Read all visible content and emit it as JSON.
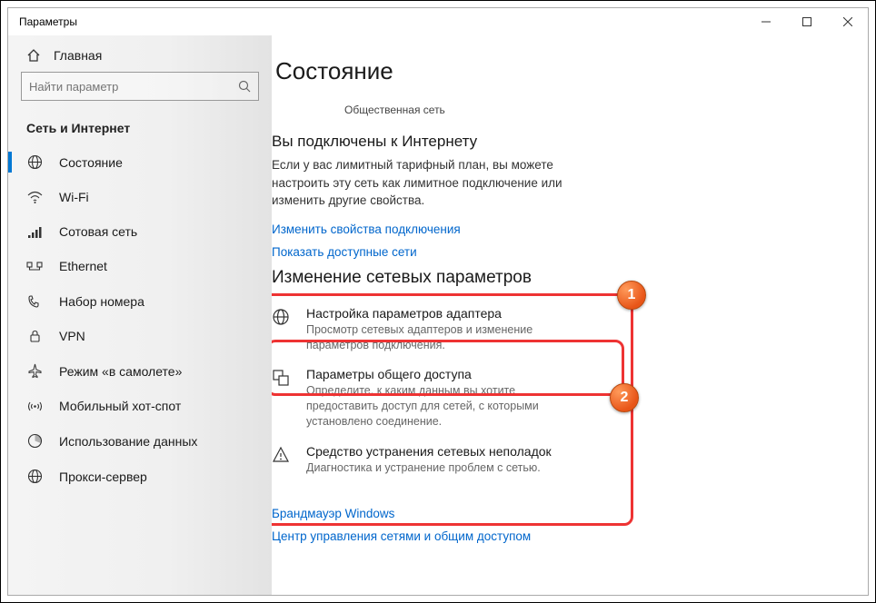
{
  "window": {
    "title": "Параметры"
  },
  "sidebar": {
    "home": "Главная",
    "search_placeholder": "Найти параметр",
    "section": "Сеть и Интернет",
    "items": [
      {
        "label": "Состояние"
      },
      {
        "label": "Wi-Fi"
      },
      {
        "label": "Сотовая сеть"
      },
      {
        "label": "Ethernet"
      },
      {
        "label": "Набор номера"
      },
      {
        "label": "VPN"
      },
      {
        "label": "Режим «в самолете»"
      },
      {
        "label": "Мобильный хот-спот"
      },
      {
        "label": "Использование данных"
      },
      {
        "label": "Прокси-сервер"
      }
    ]
  },
  "main": {
    "title": "Состояние",
    "network_type": "Общественная сеть",
    "connected_title": "Вы подключены к Интернету",
    "connected_text": "Если у вас лимитный тарифный план, вы можете настроить эту сеть как лимитное подключение или изменить другие свойства.",
    "link_change_props": "Изменить свойства подключения",
    "link_show_networks": "Показать доступные сети",
    "section2_title": "Изменение сетевых параметров",
    "opt_adapter": {
      "title": "Настройка параметров адаптера",
      "desc": "Просмотр сетевых адаптеров и изменение параметров подключения."
    },
    "opt_sharing": {
      "title": "Параметры общего доступа",
      "desc": "Определите, к каким данным вы хотите предоставить доступ для сетей, с которыми установлено соединение."
    },
    "opt_trouble": {
      "title": "Средство устранения сетевых неполадок",
      "desc": "Диагностика и устранение проблем с сетью."
    },
    "link_firewall": "Брандмауэр Windows",
    "link_center": "Центр управления сетями и общим доступом"
  },
  "annotations": {
    "badge1": "1",
    "badge2": "2"
  }
}
